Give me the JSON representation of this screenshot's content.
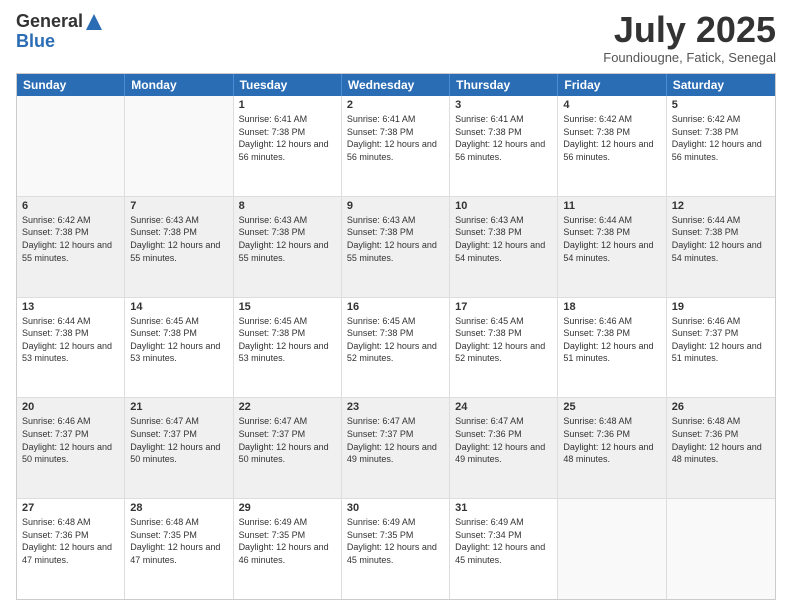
{
  "header": {
    "logo_general": "General",
    "logo_blue": "Blue",
    "month_title": "July 2025",
    "location": "Foundiougne, Fatick, Senegal"
  },
  "day_headers": [
    "Sunday",
    "Monday",
    "Tuesday",
    "Wednesday",
    "Thursday",
    "Friday",
    "Saturday"
  ],
  "weeks": [
    {
      "shaded": false,
      "cells": [
        {
          "day": "",
          "empty": true,
          "info": ""
        },
        {
          "day": "",
          "empty": true,
          "info": ""
        },
        {
          "day": "1",
          "empty": false,
          "info": "Sunrise: 6:41 AM\nSunset: 7:38 PM\nDaylight: 12 hours and 56 minutes."
        },
        {
          "day": "2",
          "empty": false,
          "info": "Sunrise: 6:41 AM\nSunset: 7:38 PM\nDaylight: 12 hours and 56 minutes."
        },
        {
          "day": "3",
          "empty": false,
          "info": "Sunrise: 6:41 AM\nSunset: 7:38 PM\nDaylight: 12 hours and 56 minutes."
        },
        {
          "day": "4",
          "empty": false,
          "info": "Sunrise: 6:42 AM\nSunset: 7:38 PM\nDaylight: 12 hours and 56 minutes."
        },
        {
          "day": "5",
          "empty": false,
          "info": "Sunrise: 6:42 AM\nSunset: 7:38 PM\nDaylight: 12 hours and 56 minutes."
        }
      ]
    },
    {
      "shaded": true,
      "cells": [
        {
          "day": "6",
          "empty": false,
          "info": "Sunrise: 6:42 AM\nSunset: 7:38 PM\nDaylight: 12 hours and 55 minutes."
        },
        {
          "day": "7",
          "empty": false,
          "info": "Sunrise: 6:43 AM\nSunset: 7:38 PM\nDaylight: 12 hours and 55 minutes."
        },
        {
          "day": "8",
          "empty": false,
          "info": "Sunrise: 6:43 AM\nSunset: 7:38 PM\nDaylight: 12 hours and 55 minutes."
        },
        {
          "day": "9",
          "empty": false,
          "info": "Sunrise: 6:43 AM\nSunset: 7:38 PM\nDaylight: 12 hours and 55 minutes."
        },
        {
          "day": "10",
          "empty": false,
          "info": "Sunrise: 6:43 AM\nSunset: 7:38 PM\nDaylight: 12 hours and 54 minutes."
        },
        {
          "day": "11",
          "empty": false,
          "info": "Sunrise: 6:44 AM\nSunset: 7:38 PM\nDaylight: 12 hours and 54 minutes."
        },
        {
          "day": "12",
          "empty": false,
          "info": "Sunrise: 6:44 AM\nSunset: 7:38 PM\nDaylight: 12 hours and 54 minutes."
        }
      ]
    },
    {
      "shaded": false,
      "cells": [
        {
          "day": "13",
          "empty": false,
          "info": "Sunrise: 6:44 AM\nSunset: 7:38 PM\nDaylight: 12 hours and 53 minutes."
        },
        {
          "day": "14",
          "empty": false,
          "info": "Sunrise: 6:45 AM\nSunset: 7:38 PM\nDaylight: 12 hours and 53 minutes."
        },
        {
          "day": "15",
          "empty": false,
          "info": "Sunrise: 6:45 AM\nSunset: 7:38 PM\nDaylight: 12 hours and 53 minutes."
        },
        {
          "day": "16",
          "empty": false,
          "info": "Sunrise: 6:45 AM\nSunset: 7:38 PM\nDaylight: 12 hours and 52 minutes."
        },
        {
          "day": "17",
          "empty": false,
          "info": "Sunrise: 6:45 AM\nSunset: 7:38 PM\nDaylight: 12 hours and 52 minutes."
        },
        {
          "day": "18",
          "empty": false,
          "info": "Sunrise: 6:46 AM\nSunset: 7:38 PM\nDaylight: 12 hours and 51 minutes."
        },
        {
          "day": "19",
          "empty": false,
          "info": "Sunrise: 6:46 AM\nSunset: 7:37 PM\nDaylight: 12 hours and 51 minutes."
        }
      ]
    },
    {
      "shaded": true,
      "cells": [
        {
          "day": "20",
          "empty": false,
          "info": "Sunrise: 6:46 AM\nSunset: 7:37 PM\nDaylight: 12 hours and 50 minutes."
        },
        {
          "day": "21",
          "empty": false,
          "info": "Sunrise: 6:47 AM\nSunset: 7:37 PM\nDaylight: 12 hours and 50 minutes."
        },
        {
          "day": "22",
          "empty": false,
          "info": "Sunrise: 6:47 AM\nSunset: 7:37 PM\nDaylight: 12 hours and 50 minutes."
        },
        {
          "day": "23",
          "empty": false,
          "info": "Sunrise: 6:47 AM\nSunset: 7:37 PM\nDaylight: 12 hours and 49 minutes."
        },
        {
          "day": "24",
          "empty": false,
          "info": "Sunrise: 6:47 AM\nSunset: 7:36 PM\nDaylight: 12 hours and 49 minutes."
        },
        {
          "day": "25",
          "empty": false,
          "info": "Sunrise: 6:48 AM\nSunset: 7:36 PM\nDaylight: 12 hours and 48 minutes."
        },
        {
          "day": "26",
          "empty": false,
          "info": "Sunrise: 6:48 AM\nSunset: 7:36 PM\nDaylight: 12 hours and 48 minutes."
        }
      ]
    },
    {
      "shaded": false,
      "cells": [
        {
          "day": "27",
          "empty": false,
          "info": "Sunrise: 6:48 AM\nSunset: 7:36 PM\nDaylight: 12 hours and 47 minutes."
        },
        {
          "day": "28",
          "empty": false,
          "info": "Sunrise: 6:48 AM\nSunset: 7:35 PM\nDaylight: 12 hours and 47 minutes."
        },
        {
          "day": "29",
          "empty": false,
          "info": "Sunrise: 6:49 AM\nSunset: 7:35 PM\nDaylight: 12 hours and 46 minutes."
        },
        {
          "day": "30",
          "empty": false,
          "info": "Sunrise: 6:49 AM\nSunset: 7:35 PM\nDaylight: 12 hours and 45 minutes."
        },
        {
          "day": "31",
          "empty": false,
          "info": "Sunrise: 6:49 AM\nSunset: 7:34 PM\nDaylight: 12 hours and 45 minutes."
        },
        {
          "day": "",
          "empty": true,
          "info": ""
        },
        {
          "day": "",
          "empty": true,
          "info": ""
        }
      ]
    }
  ]
}
